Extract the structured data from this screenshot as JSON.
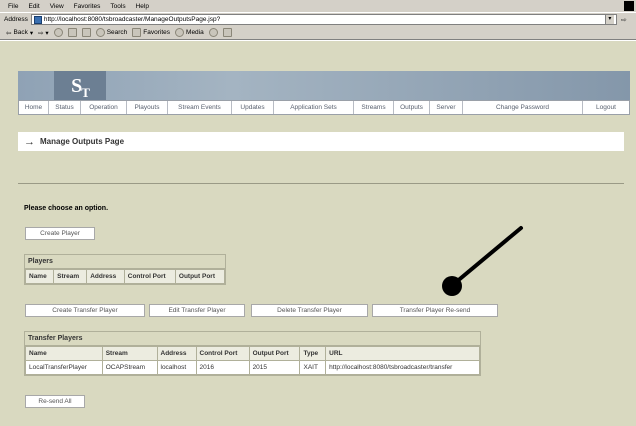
{
  "browser": {
    "menu": [
      "File",
      "Edit",
      "View",
      "Favorites",
      "Tools",
      "Help"
    ],
    "address_label": "Address",
    "url": "http://localhost:8080/tsbroadcaster/ManageOutputsPage.jsp?",
    "toolbar": [
      "Back",
      "Search",
      "Favorites",
      "Media"
    ]
  },
  "nav": {
    "items": [
      "Home",
      "Status",
      "Operation",
      "Playouts",
      "Stream Events",
      "Updates",
      "Application Sets",
      "Streams",
      "Outputs",
      "Server",
      "Change Password",
      "Logout"
    ]
  },
  "page": {
    "title": "Manage Outputs Page",
    "prompt": "Please choose an option.",
    "create_player_label": "Create Player"
  },
  "players": {
    "title": "Players",
    "columns": [
      "Name",
      "Stream",
      "Address",
      "Control Port",
      "Output Port"
    ]
  },
  "transfer_buttons": {
    "create": "Create Transfer Player",
    "edit": "Edit Transfer Player",
    "delete": "Delete Transfer Player",
    "resend": "Transfer Player Re-send"
  },
  "transfer_players": {
    "title": "Transfer Players",
    "columns": [
      "Name",
      "Stream",
      "Address",
      "Control Port",
      "Output Port",
      "Type",
      "URL"
    ],
    "rows": [
      [
        "LocalTransferPlayer",
        "OCAPStream",
        "localhost",
        "2016",
        "2015",
        "XAIT",
        "http://localhost:8080/tsbroadcaster/transfer"
      ]
    ]
  },
  "resend_all_label": "Re-send All",
  "colors": {
    "page_bg": "#d9d9c0",
    "banner": "#8fa2b5",
    "chrome": "#d4d0c8"
  }
}
